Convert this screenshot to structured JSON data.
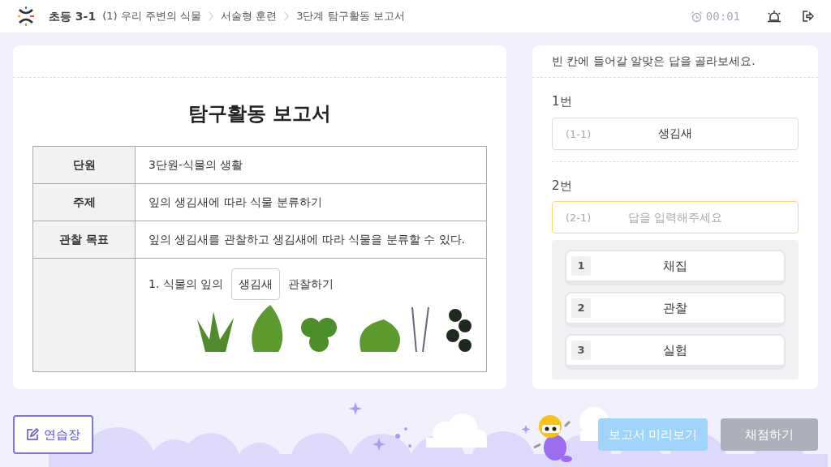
{
  "header": {
    "grade": "초등 3-1",
    "breadcrumbs": [
      "(1) 우리 주변의 식물",
      "서술형 훈련",
      "3단계 탐구활동 보고서"
    ],
    "timer": "00:01"
  },
  "report": {
    "title": "탐구활동 보고서",
    "rows": [
      {
        "kind": "text",
        "label": "단원",
        "value": "3단원-식물의 생활"
      },
      {
        "kind": "text",
        "label": "주제",
        "value": "잎의 생김새에 따라 식물 분류하기"
      },
      {
        "kind": "text",
        "label": "관찰 목표",
        "value": "잎의 생김새를 관찰하고 생김새에 따라 식물을 분류할 수 있다."
      },
      {
        "kind": "observation",
        "prefix": "1. 식물의 잎의",
        "blank": "생김새",
        "suffix": "관찰하기"
      }
    ]
  },
  "question": {
    "instruction": "빈 칸에 들어갈 알맞은 답을 골라보세요.",
    "items": [
      {
        "label": "1번",
        "code": "(1-1)",
        "value": "생김새",
        "focused": false
      },
      {
        "label": "2번",
        "code": "(2-1)",
        "placeholder": "답을 입력해주세요",
        "focused": true
      }
    ],
    "options": [
      {
        "number": "1",
        "text": "채집"
      },
      {
        "number": "2",
        "text": "관찰"
      },
      {
        "number": "3",
        "text": "실험"
      }
    ]
  },
  "footer": {
    "notebook": "연습장",
    "buttons": [
      {
        "label": "보고서 미리보기",
        "kind": "preview"
      },
      {
        "label": "채점하기",
        "kind": "grade"
      }
    ]
  }
}
